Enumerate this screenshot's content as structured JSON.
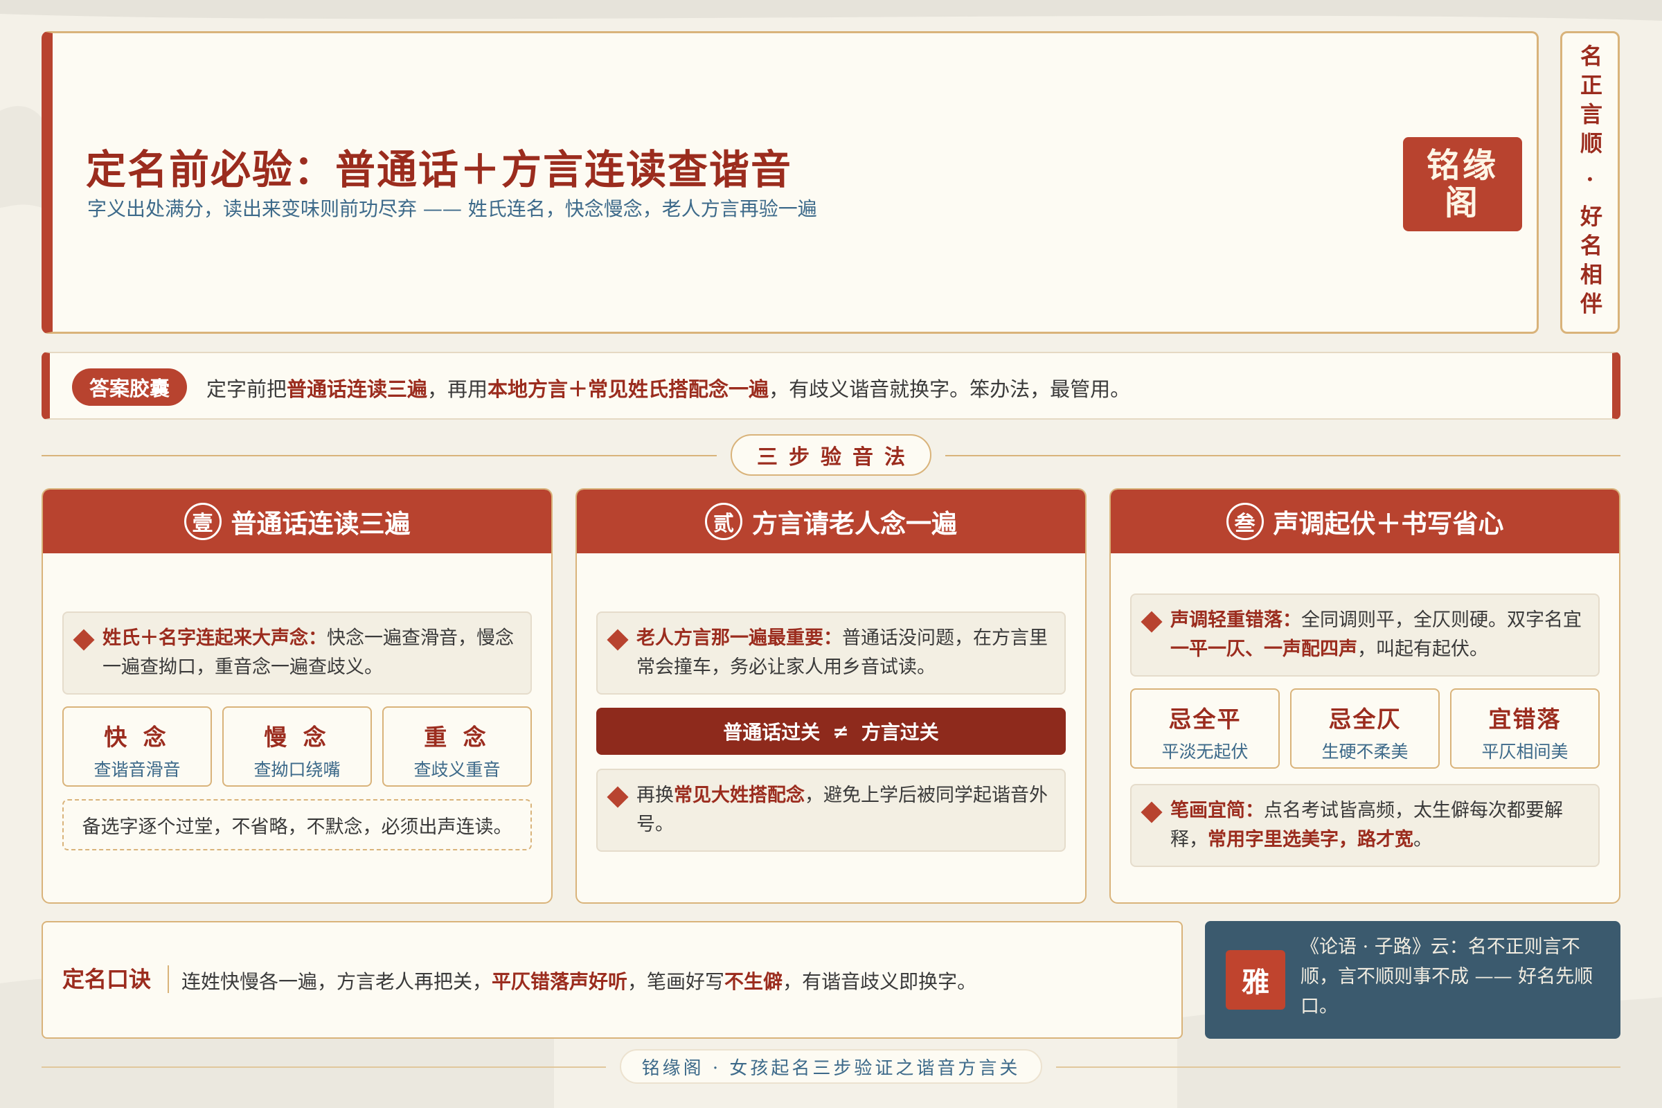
{
  "header": {
    "title": "定名前必验：普通话＋方言连读查谐音",
    "subtitle": "字义出处满分，读出来变味则前功尽弃 —— 姓氏连名，快念慢念，老人方言再验一遍",
    "seal": "铭缘阁"
  },
  "vertical_banner": "名正言顺 · 好名相伴",
  "answer": {
    "tag": "答案胶囊",
    "t1": "定字前把",
    "h1": "普通话连读三遍",
    "t2": "，再用",
    "h2": "本地方言＋常见姓氏搭配念一遍",
    "t3": "，有歧义谐音就换字。笨办法，最管用。"
  },
  "section_title": "三步验音法",
  "steps": [
    {
      "num": "壹",
      "title": "普通话连读三遍",
      "tip_bold": "姓氏＋名字连起来大声念：",
      "tip_text": "快念一遍查滑音，慢念一遍查拗口，重音念一遍查歧义。",
      "minis": [
        {
          "title": "快 念",
          "sub": "查谐音滑音"
        },
        {
          "title": "慢 念",
          "sub": "查拗口绕嘴"
        },
        {
          "title": "重 念",
          "sub": "查歧义重音"
        }
      ],
      "note": "备选字逐个过堂，不省略，不默念，必须出声连读。"
    },
    {
      "num": "贰",
      "title": "方言请老人念一遍",
      "tip_bold": "老人方言那一遍最重要：",
      "tip_text": "普通话没问题，在方言里常会撞车，务必让家人用乡音试读。",
      "bar_left": "普通话过关",
      "bar_mid": "≠",
      "bar_right": "方言过关",
      "tip2_pre": "再换",
      "tip2_bold": "常见大姓搭配念",
      "tip2_post": "，避免上学后被同学起谐音外号。"
    },
    {
      "num": "叁",
      "title": "声调起伏＋书写省心",
      "tip_bold": "声调轻重错落：",
      "tip_pre": "全同调则平，全仄则硬。双字名宜",
      "tip_hl": "一平一仄、一声配四声",
      "tip_post": "，叫起有起伏。",
      "minis": [
        {
          "title": "忌全平",
          "sub": "平淡无起伏"
        },
        {
          "title": "忌全仄",
          "sub": "生硬不柔美"
        },
        {
          "title": "宜错落",
          "sub": "平仄相间美"
        }
      ],
      "tip2_bold": "笔画宜简：",
      "tip2_text": "点名考试皆高频，太生僻每次都要解释，",
      "tip2_hl": "常用字里选美字，路才宽",
      "tip2_end": "。"
    }
  ],
  "formula": {
    "label": "定名口诀",
    "t1": "连姓快慢各一遍，方言老人再把关，",
    "h1": "平仄错落声好听",
    "t2": "，笔画好写",
    "h2": "不生僻",
    "t3": "，有谐音歧义即换字。"
  },
  "quote": {
    "seal": "雅",
    "text": "《论语 · 子路》云：名不正则言不顺，言不顺则事不成 —— 好名先顺口。"
  },
  "footer": "铭缘阁 · 女孩起名三步验证之谐音方言关",
  "colors": {
    "accent": "#b8432f",
    "dark_red": "#8e2a1c",
    "gold": "#d9b37a",
    "blue": "#3d6a8a",
    "navy": "#3b5a6e",
    "paper": "#fdfbf3"
  }
}
